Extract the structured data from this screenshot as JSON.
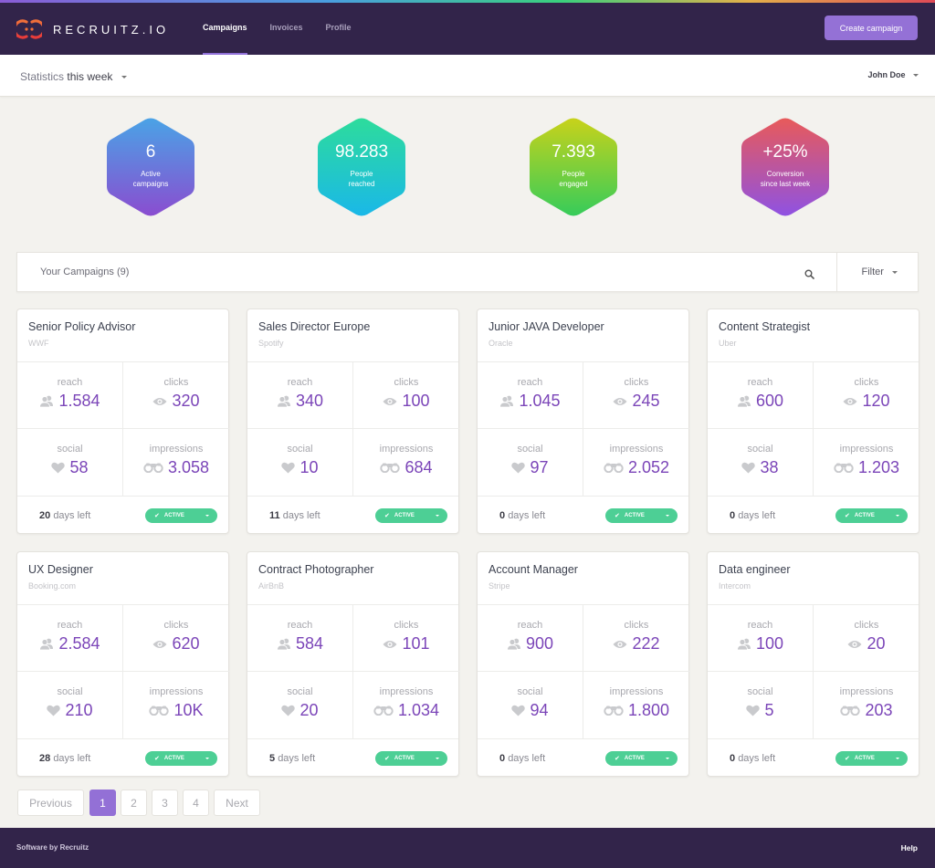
{
  "app": {
    "brand": "RECRUITZ.IO",
    "accent_color": "#9471d6",
    "header_bg": "#32244a",
    "active_badge_color": "#4dcf95",
    "value_color": "#7b45b8"
  },
  "nav": {
    "items": [
      {
        "label": "Campaigns",
        "active": true
      },
      {
        "label": "Invoices",
        "active": false
      },
      {
        "label": "Profile",
        "active": false
      }
    ],
    "create_button": "Create campaign"
  },
  "subbar": {
    "stats_prefix": "Statistics",
    "stats_period": "this week",
    "user_name": "John Doe"
  },
  "summary": [
    {
      "value": "6",
      "label_line1": "Active",
      "label_line2": "campaigns",
      "gradient": [
        "#4aa3e6",
        "#8a4dd0"
      ]
    },
    {
      "value": "98.283",
      "label_line1": "People",
      "label_line2": "reached",
      "gradient": [
        "#2ddc9c",
        "#1ab8e8"
      ]
    },
    {
      "value": "7.393",
      "label_line1": "People",
      "label_line2": "engaged",
      "gradient": [
        "#c8d21a",
        "#36cc5a"
      ]
    },
    {
      "value": "+25%",
      "label_line1": "Conversion",
      "label_line2": "since last week",
      "gradient": [
        "#e85a5a",
        "#8f52e2"
      ]
    }
  ],
  "campaigns_bar": {
    "title": "Your Campaigns (9)",
    "filter_label": "Filter"
  },
  "metric_labels": {
    "reach": "reach",
    "clicks": "clicks",
    "social": "social",
    "impressions": "impressions",
    "days_suffix": "days left"
  },
  "campaigns": [
    {
      "title": "Senior Policy Advisor",
      "company": "WWF",
      "reach": "1.584",
      "clicks": "320",
      "social": "58",
      "impressions": "3.058",
      "days": "20",
      "status": "ACTIVE"
    },
    {
      "title": "Sales Director Europe",
      "company": "Spotify",
      "reach": "340",
      "clicks": "100",
      "social": "10",
      "impressions": "684",
      "days": "11",
      "status": "ACTIVE"
    },
    {
      "title": "Junior JAVA Developer",
      "company": "Oracle",
      "reach": "1.045",
      "clicks": "245",
      "social": "97",
      "impressions": "2.052",
      "days": "0",
      "status": "ACTIVE"
    },
    {
      "title": "Content Strategist",
      "company": "Uber",
      "reach": "600",
      "clicks": "120",
      "social": "38",
      "impressions": "1.203",
      "days": "0",
      "status": "ACTIVE"
    },
    {
      "title": "UX Designer",
      "company": "Booking.com",
      "reach": "2.584",
      "clicks": "620",
      "social": "210",
      "impressions": "10K",
      "days": "28",
      "status": "ACTIVE"
    },
    {
      "title": "Contract Photographer",
      "company": "AirBnB",
      "reach": "584",
      "clicks": "101",
      "social": "20",
      "impressions": "1.034",
      "days": "5",
      "status": "ACTIVE"
    },
    {
      "title": "Account Manager",
      "company": "Stripe",
      "reach": "900",
      "clicks": "222",
      "social": "94",
      "impressions": "1.800",
      "days": "0",
      "status": "ACTIVE"
    },
    {
      "title": "Data engineer",
      "company": "Intercom",
      "reach": "100",
      "clicks": "20",
      "social": "5",
      "impressions": "203",
      "days": "0",
      "status": "ACTIVE"
    }
  ],
  "pagination": {
    "previous": "Previous",
    "pages": [
      "1",
      "2",
      "3",
      "4"
    ],
    "current": "1",
    "next": "Next"
  },
  "footer": {
    "left": "Software by Recruitz",
    "right": "Help"
  }
}
